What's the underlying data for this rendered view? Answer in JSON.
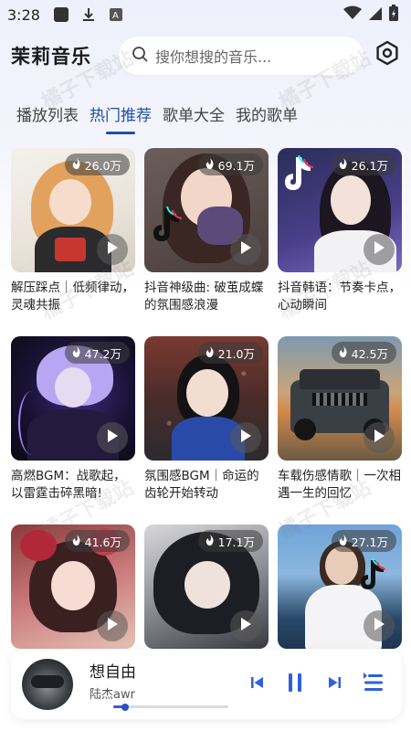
{
  "status_bar": {
    "time": "3:28"
  },
  "header": {
    "app_title": "茉莉音乐",
    "search_placeholder": "搜你想搜的音乐...",
    "settings_icon": "settings-icon"
  },
  "tabs": [
    {
      "label": "播放列表",
      "active": false
    },
    {
      "label": "热门推荐",
      "active": true
    },
    {
      "label": "歌单大全",
      "active": false
    },
    {
      "label": "我的歌单",
      "active": false
    }
  ],
  "playlists": [
    {
      "title": "解压踩点｜低频律动，灵魂共振",
      "plays": "26.0万"
    },
    {
      "title": "抖音神级曲: 破茧成蝶的氛围感浪漫",
      "plays": "69.1万"
    },
    {
      "title": "抖音韩语：节奏卡点，心动瞬间",
      "plays": "26.1万"
    },
    {
      "title": "高燃BGM：战歌起，以雷霆击碎黑暗!",
      "plays": "47.2万"
    },
    {
      "title": "氛围感BGM｜命运的齿轮开始转动",
      "plays": "21.0万"
    },
    {
      "title": "车载伤感情歌｜一次相遇一生的回忆",
      "plays": "42.5万"
    },
    {
      "title": "",
      "plays": "41.6万"
    },
    {
      "title": "",
      "plays": "17.1万"
    },
    {
      "title": "",
      "plays": "27.1万"
    }
  ],
  "player": {
    "song_title": "想自由",
    "artist": "陆杰awr",
    "progress": 0.1
  },
  "watermark": "橘子下载站",
  "colors": {
    "accent": "#1f4fa8",
    "progress": "#3b5bd9"
  }
}
